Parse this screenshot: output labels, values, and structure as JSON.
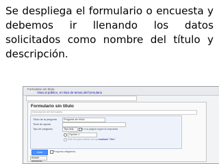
{
  "caption": "Se despliega el formulario o encuesta y debemos ir llenando los datos solicitados como nombre del título y descripción.",
  "screenshot": {
    "topbar": {
      "title": "Formulario sin título",
      "notice": "Vista al público, en lista de temas del formulario"
    },
    "form": {
      "title": "Formulario sin título",
      "description_placeholder": "Descripción del formulario",
      "question": {
        "title_label": "Título de la pregunta",
        "title_value": "Pregunta sin título",
        "help_label": "Texto de ayuda",
        "type_label": "Tipo de pregunta",
        "type_value": "Tipo test",
        "go_to_page_label": "Ir a la página según la respuesta",
        "option_1": "Opción 1",
        "option_other": "Haz clic para añadir una opción",
        "add_other": "o añadir \"Otro\"",
        "required_label": "Pregunta obligatoria",
        "done_button": "Listo"
      },
      "add_item": "Añadir elemento"
    }
  }
}
